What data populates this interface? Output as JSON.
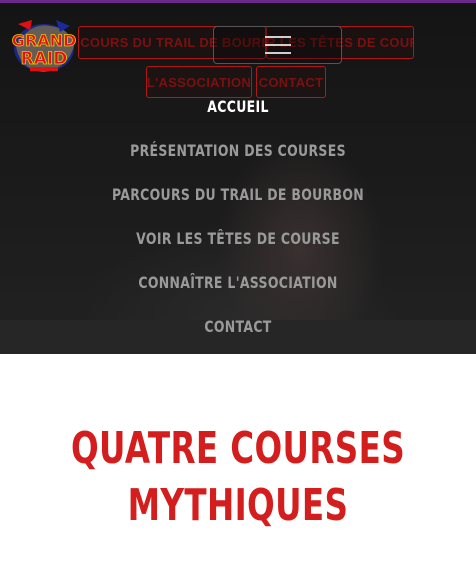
{
  "colors": {
    "accent": "#d41d1d",
    "menu_text": "#9a9a9a",
    "menu_active": "#ffffff",
    "top_bar": "#6a2a8a"
  },
  "logo": {
    "text_top": "GRAND",
    "text_bottom": "RAID",
    "icon": "grand-raid-logo"
  },
  "ghost_nav": [
    "PARCOURS DU TRAIL DE BOURBON",
    "VOIR LES TÊTES DE COURSE",
    "L'ASSOCIATION",
    "CONTACT"
  ],
  "toggler": {
    "icon": "hamburger-menu-icon"
  },
  "menu": {
    "items": [
      {
        "label": "ACCUEIL",
        "active": true
      },
      {
        "label": "PRÉSENTATION DES COURSES",
        "active": false
      },
      {
        "label": "PARCOURS DU TRAIL DE BOURBON",
        "active": false
      },
      {
        "label": "VOIR LES TÊTES DE COURSE",
        "active": false
      },
      {
        "label": "CONNAÎTRE L'ASSOCIATION",
        "active": false
      },
      {
        "label": "CONTACT",
        "active": false
      }
    ]
  },
  "section": {
    "title_line1": "QUATRE COURSES",
    "title_line2": "MYTHIQUES"
  }
}
